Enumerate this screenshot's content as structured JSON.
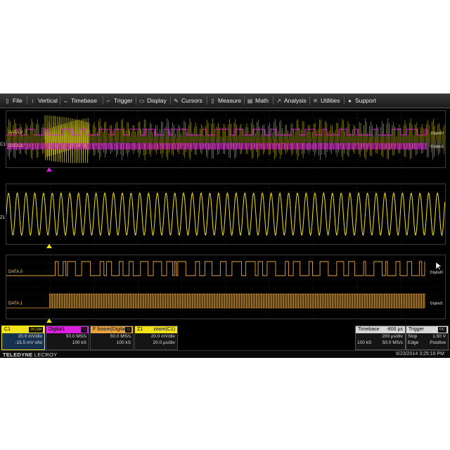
{
  "menu": [
    {
      "icon": "file-icon",
      "glyph": "▯",
      "label": "File"
    },
    {
      "icon": "vertical-icon",
      "glyph": "↕",
      "label": "Vertical"
    },
    {
      "icon": "timebase-icon",
      "glyph": "↔",
      "label": "Timebase"
    },
    {
      "icon": "trigger-icon",
      "glyph": "⌐",
      "label": "Trigger"
    },
    {
      "icon": "display-icon",
      "glyph": "▭",
      "label": "Display"
    },
    {
      "icon": "cursors-icon",
      "glyph": "✎",
      "label": "Cursors"
    },
    {
      "icon": "measure-icon",
      "glyph": "▯",
      "label": "Measure"
    },
    {
      "icon": "math-icon",
      "glyph": "▤",
      "label": "Math"
    },
    {
      "icon": "analysis-icon",
      "glyph": "↗",
      "label": "Analysis"
    },
    {
      "icon": "utilities-icon",
      "glyph": "✕",
      "label": "Utilities"
    },
    {
      "icon": "support-icon",
      "glyph": "●",
      "label": "Support"
    }
  ],
  "top_grid": {
    "ch_marker": "C1",
    "lane0": "DATA.0",
    "lane1": "DATA.1",
    "tag0": "Digital0",
    "tag1": "Digital1"
  },
  "mid_grid": {
    "ch_marker": "Z1"
  },
  "low_grid": {
    "lane0": "DATA.0",
    "lane1": "DATA.1",
    "tag0": "Digital0",
    "tag1": "Digital1"
  },
  "descriptors": {
    "c1": {
      "title": "C1",
      "badge": "DC1M",
      "line1": "20.0 mV/div",
      "line2": "-15.5 mV ofst"
    },
    "digital1": {
      "title": "Digital1",
      "badge": "⊡",
      "line1": "50.0 MS/s",
      "line2": "100 kS"
    },
    "fzoom": {
      "title": "F fzoom(Digita",
      "badge": "⊡",
      "line1": "50.0 MS/s",
      "line2": "100 kS"
    },
    "z1": {
      "title": "Z1",
      "title2": "zoom(C1)",
      "line1": "20.0 mV/div",
      "line2": "20.0 µs/div"
    },
    "timebase": {
      "title": "Timebase",
      "value": "-800 µs",
      "line1": "200 µs/div",
      "line2a": "100 kS",
      "line2b": "50.0 MS/s"
    },
    "trigger": {
      "title": "Trigger",
      "badge": "DC",
      "row1a": "Stop",
      "row1b": "1.50 V",
      "row2a": "Edge",
      "row2b": "Positive"
    }
  },
  "brand": {
    "name": "TELEDYNE",
    "model": "LECROY"
  },
  "datetime": "6/23/2014 3:25:16 PM",
  "colors": {
    "c1": "#f2e21c",
    "digital": "#e01ee0",
    "digital_zoom": "#e8a43a",
    "grid": "#3b3b3b",
    "lane_label": "#ffc857"
  }
}
